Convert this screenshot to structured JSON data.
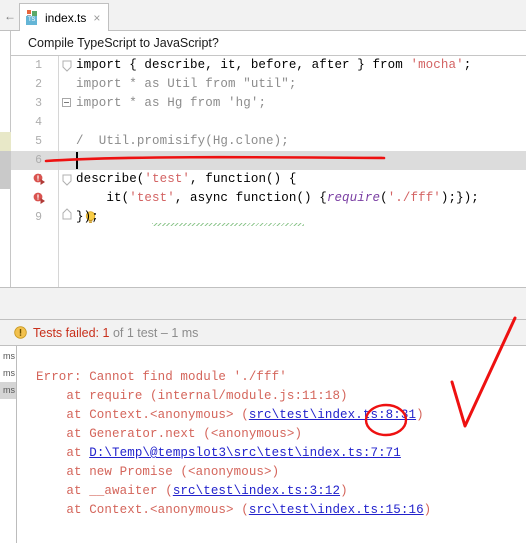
{
  "window": {
    "title": "index.ts"
  },
  "tabbar": {
    "back_arrow": "←",
    "tab_icon_label": "TS",
    "tab_title": "index.ts",
    "close_glyph": "×"
  },
  "banner": {
    "text": "Compile TypeScript to JavaScript?"
  },
  "editor": {
    "lines": [
      {
        "number": "1",
        "segments": [
          {
            "text": "import { describe, it, before, after } from ",
            "style": "plain"
          },
          {
            "text": "'mocha'",
            "style": "string-red"
          },
          {
            "text": ";",
            "style": "plain"
          }
        ]
      },
      {
        "number": "2",
        "segments": [
          {
            "text": "import * as Util from ",
            "style": "dim"
          },
          {
            "text": "\"util\"",
            "style": "dim"
          },
          {
            "text": ";",
            "style": "dim"
          }
        ]
      },
      {
        "number": "3",
        "segments": [
          {
            "text": "import * as Hg from ",
            "style": "dim"
          },
          {
            "text": "'hg'",
            "style": "dim"
          },
          {
            "text": ";",
            "style": "dim"
          }
        ]
      },
      {
        "number": "4",
        "segments": []
      },
      {
        "number": "5",
        "segments": [
          {
            "text": "/",
            "style": "comment"
          },
          {
            "text": "  Util.promisify(Hg.clone);",
            "style": "comment"
          }
        ]
      },
      {
        "number": "6",
        "segments": []
      },
      {
        "number": "7",
        "segments": [
          {
            "text": "describe(",
            "style": "plain"
          },
          {
            "text": "'test'",
            "style": "string-red"
          },
          {
            "text": ", function() {",
            "style": "plain"
          }
        ]
      },
      {
        "number": "8",
        "segments": [
          {
            "text": "    it(",
            "style": "plain"
          },
          {
            "text": "'test'",
            "style": "string-red"
          },
          {
            "text": ", async function() {",
            "style": "plain"
          },
          {
            "text": "require",
            "style": "fn"
          },
          {
            "text": "(",
            "style": "plain"
          },
          {
            "text": "'./fff'",
            "style": "string-red"
          },
          {
            "text": ");});",
            "style": "plain"
          }
        ]
      },
      {
        "number": "9",
        "segments": [
          {
            "text": "});",
            "style": "plain"
          }
        ]
      }
    ],
    "current_line": "6",
    "gutter_run_icon_lines": [
      "7",
      "8"
    ]
  },
  "status": {
    "icon": "warning-icon",
    "failed_label": "Tests failed:",
    "failed_count": "1",
    "of_label": "of 1 test",
    "duration": "– 1 ms"
  },
  "console": {
    "sidebar_rows": [
      "ms",
      "ms",
      "ms"
    ],
    "sidebar_selected_index": 2,
    "lines": [
      {
        "segments": [
          {
            "text": "Error: Cannot find module './fff'",
            "style": "err"
          }
        ]
      },
      {
        "segments": [
          {
            "text": "    at require (internal/module.js:11:18)",
            "style": "err"
          }
        ]
      },
      {
        "segments": [
          {
            "text": "    at Context.<anonymous> (",
            "style": "err"
          },
          {
            "text": "src\\test\\index.ts:8:31",
            "style": "link"
          },
          {
            "text": ")",
            "style": "err"
          }
        ]
      },
      {
        "segments": [
          {
            "text": "    at Generator.next (<anonymous>)",
            "style": "err"
          }
        ]
      },
      {
        "segments": [
          {
            "text": "    at ",
            "style": "err"
          },
          {
            "text": "D:\\Temp\\@tempslot3\\src\\test\\index.ts:7:71",
            "style": "link"
          }
        ]
      },
      {
        "segments": [
          {
            "text": "    at new Promise (<anonymous>)",
            "style": "err"
          }
        ]
      },
      {
        "segments": [
          {
            "text": "    at __awaiter (",
            "style": "err"
          },
          {
            "text": "src\\test\\index.ts:3:12",
            "style": "link"
          },
          {
            "text": ")",
            "style": "err"
          }
        ]
      },
      {
        "segments": [
          {
            "text": "    at Context.<anonymous> (",
            "style": "err"
          },
          {
            "text": "src\\test\\index.ts:15:16",
            "style": "link"
          },
          {
            "text": ")",
            "style": "err"
          }
        ]
      }
    ]
  },
  "annotations": {
    "underline_color": "#ee1111",
    "circle_color": "#ee1111",
    "check_color": "#ee1111",
    "circled_text": "8:31"
  }
}
